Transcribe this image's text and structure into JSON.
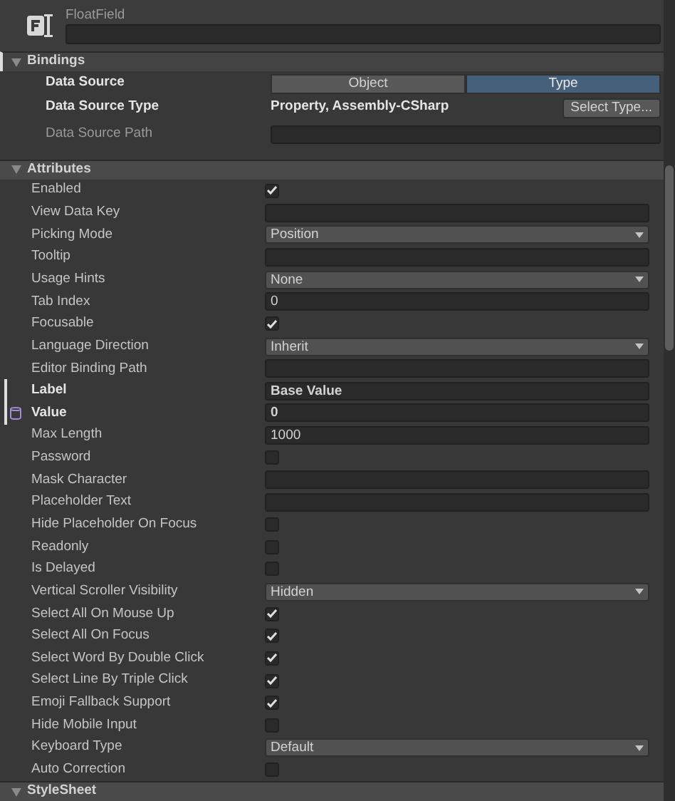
{
  "element": {
    "type_label": "FloatField"
  },
  "bindings": {
    "title": "Bindings",
    "expanded": true,
    "modified": true,
    "data_source": {
      "label": "Data Source",
      "modified": true,
      "options": [
        {
          "label": "Object",
          "selected": false
        },
        {
          "label": "Type",
          "selected": true
        }
      ]
    },
    "data_source_type": {
      "label": "Data Source Type",
      "modified": true,
      "value": "Property, Assembly-CSharp",
      "button": "Select Type..."
    },
    "data_source_path": {
      "label": "Data Source Path",
      "modified": false
    }
  },
  "attributes": {
    "title": "Attributes",
    "expanded": true,
    "rows": [
      {
        "label": "Enabled",
        "kind": "checkbox",
        "checked": true
      },
      {
        "label": "View Data Key",
        "kind": "text"
      },
      {
        "label": "Picking Mode",
        "kind": "dropdown",
        "value": "Position"
      },
      {
        "label": "Tooltip",
        "kind": "text"
      },
      {
        "label": "Usage Hints",
        "kind": "dropdown",
        "value": "None"
      },
      {
        "label": "Tab Index",
        "kind": "text",
        "value": "0"
      },
      {
        "label": "Focusable",
        "kind": "checkbox",
        "checked": true
      },
      {
        "label": "Language Direction",
        "kind": "dropdown",
        "value": "Inherit"
      },
      {
        "label": "Editor Binding Path",
        "kind": "text"
      },
      {
        "label": "Label",
        "kind": "text",
        "value": "Base Value",
        "modified": true
      },
      {
        "label": "Value",
        "kind": "text",
        "value": "0",
        "modified": true,
        "bound": true
      },
      {
        "label": "Max Length",
        "kind": "text",
        "value": "1000"
      },
      {
        "label": "Password",
        "kind": "checkbox",
        "checked": false
      },
      {
        "label": "Mask Character",
        "kind": "text"
      },
      {
        "label": "Placeholder Text",
        "kind": "text"
      },
      {
        "label": "Hide Placeholder On Focus",
        "kind": "checkbox",
        "checked": false
      },
      {
        "label": "Readonly",
        "kind": "checkbox",
        "checked": false
      },
      {
        "label": "Is Delayed",
        "kind": "checkbox",
        "checked": false
      },
      {
        "label": "Vertical Scroller Visibility",
        "kind": "dropdown",
        "value": "Hidden"
      },
      {
        "label": "Select All On Mouse Up",
        "kind": "checkbox",
        "checked": true
      },
      {
        "label": "Select All On Focus",
        "kind": "checkbox",
        "checked": true
      },
      {
        "label": "Select Word By Double Click",
        "kind": "checkbox",
        "checked": true
      },
      {
        "label": "Select Line By Triple Click",
        "kind": "checkbox",
        "checked": true
      },
      {
        "label": "Emoji Fallback Support",
        "kind": "checkbox",
        "checked": true
      },
      {
        "label": "Hide Mobile Input",
        "kind": "checkbox",
        "checked": false
      },
      {
        "label": "Keyboard Type",
        "kind": "dropdown",
        "value": "Default"
      },
      {
        "label": "Auto Correction",
        "kind": "checkbox",
        "checked": false
      }
    ]
  },
  "stylesheet": {
    "title": "StyleSheet",
    "expanded": true
  }
}
